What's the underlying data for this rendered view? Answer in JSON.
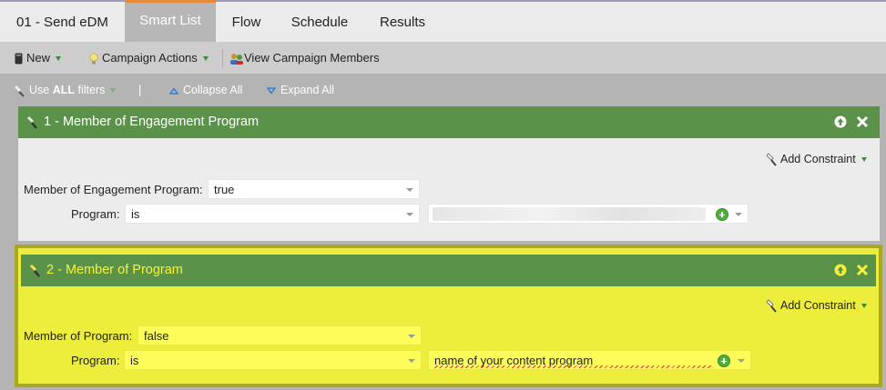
{
  "tabs": [
    {
      "label": "01 - Send eDM"
    },
    {
      "label": "Smart List"
    },
    {
      "label": "Flow"
    },
    {
      "label": "Schedule"
    },
    {
      "label": "Results"
    }
  ],
  "toolbar": {
    "new_label": "New",
    "campaign_actions_label": "Campaign Actions",
    "view_members_label": "View Campaign Members"
  },
  "filterbar": {
    "use_prefix": "Use ",
    "use_bold": "ALL",
    "use_suffix": " filters",
    "separator": "|",
    "collapse_label": "Collapse All",
    "expand_label": "Expand All"
  },
  "filters": [
    {
      "title": "1 - Member of Engagement Program",
      "add_constraint": "Add Constraint",
      "field1_label": "Member of Engagement Program:",
      "field1_value": "true",
      "program_label": "Program:",
      "program_operator": "is",
      "program_value": ""
    },
    {
      "title": "2 - Member of Program",
      "add_constraint": "Add Constraint",
      "field1_label": "Member of Program:",
      "field1_value": "false",
      "program_label": "Program:",
      "program_operator": "is",
      "program_value": "name of your content program"
    }
  ],
  "colors": {
    "header_green": "#5b9249",
    "highlight_yellow": "#eded3c",
    "highlight_border": "#a8a826",
    "active_tab_accent": "#e58a3a"
  }
}
